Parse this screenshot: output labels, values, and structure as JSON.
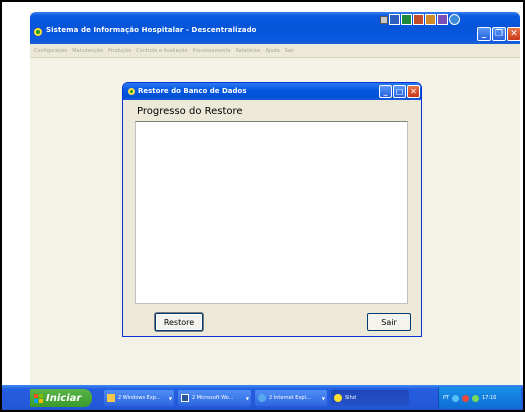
{
  "app": {
    "title": "Sistema de Informação Hospitalar - Descentralizado",
    "menu": [
      "Configuração",
      "Manutenção",
      "Produção",
      "Controle e Avaliação",
      "Processamento",
      "Relatórios",
      "Ajuda",
      "Sair"
    ]
  },
  "dialog": {
    "title": "Restore do Banco de Dados",
    "heading": "Progresso do Restore",
    "restore_label": "Restore",
    "exit_label": "Sair"
  },
  "taskbar": {
    "start_label": "Iniciar",
    "buttons": [
      {
        "label": "2 Windows Exp...",
        "icon": "folder-icon"
      },
      {
        "label": "2 Microsoft Wo...",
        "icon": "word-icon"
      },
      {
        "label": "2 Internet Expl...",
        "icon": "ie-icon"
      },
      {
        "label": "Sihd",
        "icon": "app-icon"
      }
    ],
    "tray": {
      "language": "PT",
      "time": "17:10"
    }
  },
  "colors": {
    "titlebar": "#0654d8",
    "window_bg": "#ece9d8",
    "close_red": "#c83818",
    "start_green": "#3a9a2c"
  }
}
